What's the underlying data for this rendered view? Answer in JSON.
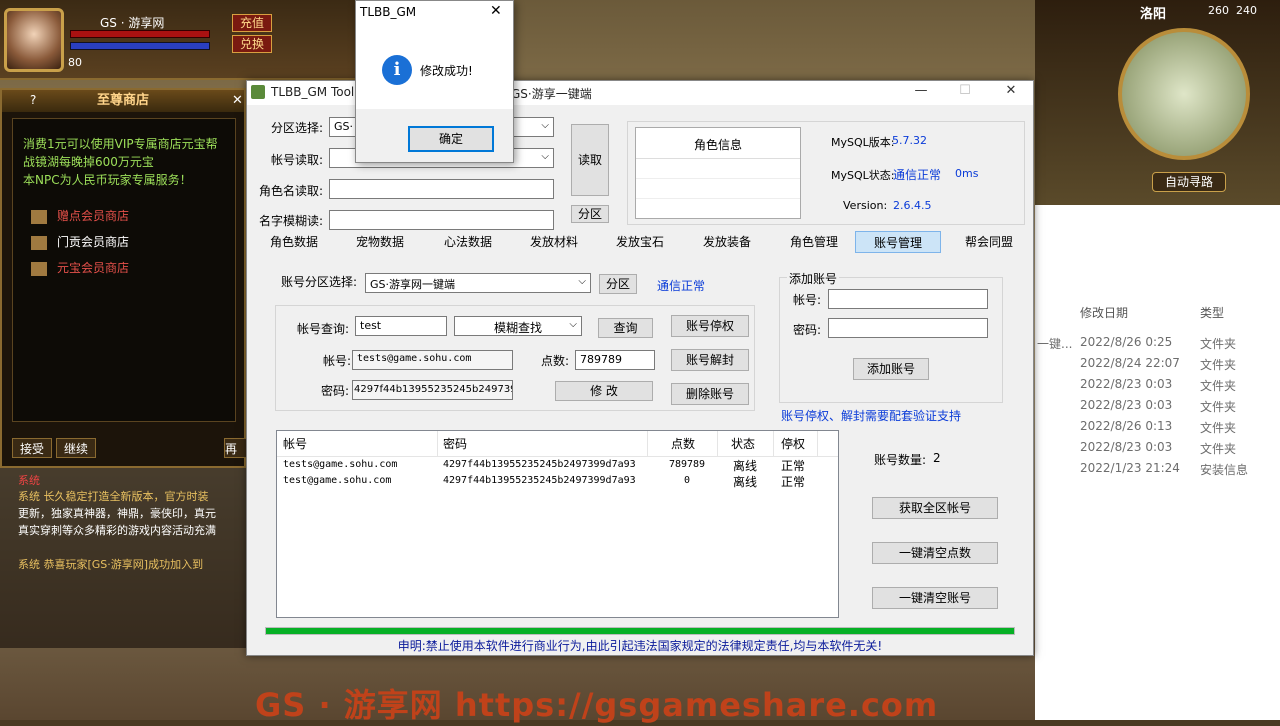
{
  "game": {
    "player_name": "GS · 游享网",
    "level": "80",
    "btn_fill": "充值",
    "btn_exchange": "兑换",
    "map_name": "洛阳",
    "map_x": "260",
    "map_y": "240",
    "auto_path": "自动寻路",
    "shop_title": "至尊商店",
    "shop_desc": [
      "消费1元可以使用VIP专属商店元宝帮",
      "战镜湖每晚掉600万元宝",
      "本NPC为人民币玩家专属服务！"
    ],
    "shop_items": [
      "赠点会员商店",
      "门贡会员商店",
      "元宝会员商店"
    ],
    "shop_accept": "接受",
    "shop_continue": "继续",
    "shop_return": "再见",
    "chat_lines": [
      "系统",
      "系统 长久稳定打造全新版本，官方时装",
      "更新，独家真神器，神鼎，豪侠印，真元",
      "真实穿刺等众多精彩的游戏内容活动充满",
      "系统 恭喜玩家[GS·游享网]成功加入到"
    ],
    "watermark": "GS · 游享网  https://gsgameshare.com"
  },
  "explorer": {
    "col_date": "修改日期",
    "col_type": "类型",
    "trunc": "一键...",
    "rows": [
      {
        "date": "2022/8/26 0:25",
        "type": "文件夹"
      },
      {
        "date": "2022/8/24 22:07",
        "type": "文件夹"
      },
      {
        "date": "2022/8/23 0:03",
        "type": "文件夹"
      },
      {
        "date": "2022/8/23 0:03",
        "type": "文件夹"
      },
      {
        "date": "2022/8/26 0:13",
        "type": "文件夹"
      },
      {
        "date": "2022/8/23 0:03",
        "type": "文件夹"
      },
      {
        "date": "2022/1/23 21:24",
        "type": "安装信息"
      }
    ]
  },
  "tool": {
    "title": "TLBB_GM Tool",
    "title_suffix": "GS·游享一键端",
    "lbl_partition": "分区选择:",
    "partition_value": "GS·",
    "lbl_account_read": "帐号读取:",
    "lbl_role_read": "角色名读取:",
    "lbl_fuzzy": "名字模糊读:",
    "btn_read": "读取",
    "btn_partition": "分区",
    "role_info_title": "角色信息",
    "mysql_version_lbl": "MySQL版本:",
    "mysql_version": "5.7.32",
    "mysql_status_lbl": "MySQL状态:",
    "mysql_status": "通信正常",
    "mysql_latency": "0ms",
    "version_lbl": "Version:",
    "version": "2.6.4.5",
    "tabs": [
      "角色数据",
      "宠物数据",
      "心法数据",
      "发放材料",
      "发放宝石",
      "发放装备",
      "角色管理",
      "账号管理",
      "帮会同盟"
    ],
    "active_tab": "账号管理",
    "lbl_acct_partition": "账号分区选择:",
    "acct_partition_value": "GS·游享网一键端",
    "btn_acct_partition": "分区",
    "acct_status": "通信正常",
    "add_group_title": "添加账号",
    "lbl_add_account": "帐号:",
    "lbl_add_password": "密码:",
    "btn_add_account": "添加账号",
    "lbl_query": "帐号查询:",
    "query_value": "test",
    "query_mode": "模糊查找",
    "btn_query": "查询",
    "btn_suspend": "账号停权",
    "lbl_account": "帐号:",
    "account_value": "tests@game.sohu.com",
    "lbl_points": "点数:",
    "points_value": "789789",
    "btn_unsuspend": "账号解封",
    "lbl_password": "密码:",
    "password_value": "4297f44b13955235245b249739",
    "btn_modify": "修  改",
    "btn_delete": "删除账号",
    "notice": "账号停权、解封需要配套验证支持",
    "grid_headers": [
      "帐号",
      "密码",
      "点数",
      "状态",
      "停权"
    ],
    "grid_rows": [
      [
        "tests@game.sohu.com",
        "4297f44b13955235245b2497399d7a93",
        "789789",
        "离线",
        "正常"
      ],
      [
        "test@game.sohu.com",
        "4297f44b13955235245b2497399d7a93",
        "0",
        "离线",
        "正常"
      ]
    ],
    "account_count_lbl": "账号数量:",
    "account_count": "2",
    "btn_get_all": "获取全区帐号",
    "btn_clear_points": "一键清空点数",
    "btn_clear_accounts": "一键清空账号",
    "disclaimer": "申明:禁止使用本软件进行商业行为,由此引起违法国家规定的法律规定责任,均与本软件无关!"
  },
  "msgbox": {
    "title": "TLBB_GM",
    "message": "修改成功!",
    "ok": "确定"
  },
  "colors": {
    "accent": "#0078d7",
    "progress": "#06b025",
    "link_blue": "#0a3bd8"
  }
}
